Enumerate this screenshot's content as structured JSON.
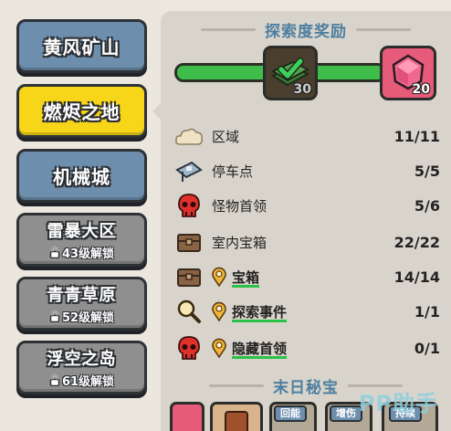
{
  "sidebar": {
    "items": [
      {
        "name": "黄风矿山",
        "state": "unlocked"
      },
      {
        "name": "燃烬之地",
        "state": "active"
      },
      {
        "name": "机械城",
        "state": "unlocked"
      },
      {
        "name": "雷暴大区",
        "state": "locked",
        "lock_text": "43级解锁"
      },
      {
        "name": "青青草原",
        "state": "locked",
        "lock_text": "52级解锁"
      },
      {
        "name": "浮空之岛",
        "state": "locked",
        "lock_text": "61级解锁"
      }
    ]
  },
  "exploration": {
    "title": "探索度奖励",
    "progress_fraction": 1.0,
    "rewards": [
      {
        "icon": "cash-bundle-icon",
        "count": "30",
        "claimed": true
      },
      {
        "icon": "pink-gem-icon",
        "count": "20",
        "claimed": false
      }
    ]
  },
  "stats": [
    {
      "icon": "cloud-icon",
      "label": "区域",
      "value": "11/11"
    },
    {
      "icon": "parking-sign-icon",
      "label": "停车点",
      "value": "5/5"
    },
    {
      "icon": "red-skull-icon",
      "label": "怪物首领",
      "value": "5/6"
    },
    {
      "icon": "brown-chest-icon",
      "label": "室内宝箱",
      "value": "22/22"
    },
    {
      "icon": "brown-chest-icon",
      "label": "宝箱",
      "value": "14/14",
      "has_pin": true
    },
    {
      "icon": "magnifier-icon",
      "label": "探索事件",
      "value": "1/1",
      "has_pin": true
    },
    {
      "icon": "red-skull-icon",
      "label": "隐藏首领",
      "value": "0/1",
      "has_pin": true
    }
  ],
  "secret": {
    "title": "末日秘宝",
    "tags": [
      "回能",
      "增伤",
      "持续"
    ]
  },
  "watermark": "PP助手",
  "colors": {
    "accent_blue": "#4d7fa0",
    "active_yellow": "#f7d61a",
    "progress_green": "#3fbd4b",
    "button_blue": "#6d8eac",
    "locked_gray": "#8f8f8f"
  }
}
